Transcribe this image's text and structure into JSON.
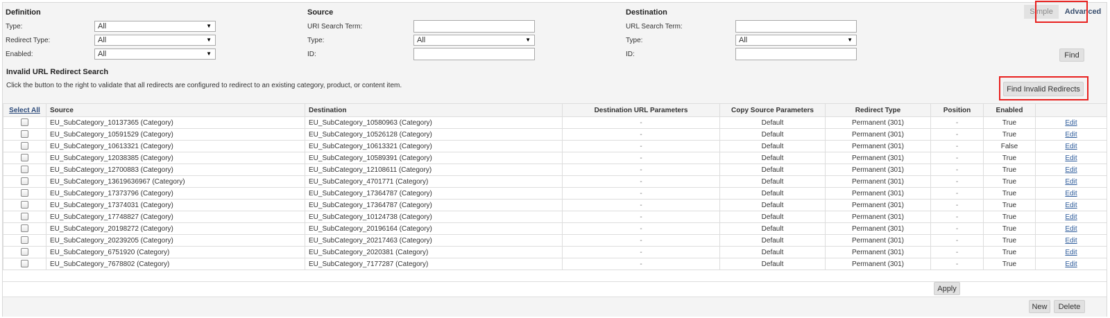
{
  "modes": {
    "simple": "Simple",
    "advanced": "Advanced"
  },
  "definition": {
    "title": "Definition",
    "type_label": "Type:",
    "type_value": "All",
    "redirect_type_label": "Redirect Type:",
    "redirect_type_value": "All",
    "enabled_label": "Enabled:",
    "enabled_value": "All"
  },
  "source": {
    "title": "Source",
    "search_label": "URI Search Term:",
    "search_value": "",
    "type_label": "Type:",
    "type_value": "All",
    "id_label": "ID:",
    "id_value": ""
  },
  "destination": {
    "title": "Destination",
    "search_label": "URL Search Term:",
    "search_value": "",
    "type_label": "Type:",
    "type_value": "All",
    "id_label": "ID:",
    "id_value": ""
  },
  "find_button": "Find",
  "invalid": {
    "title": "Invalid URL Redirect Search",
    "description": "Click the button to the right to validate that all redirects are configured to redirect to an existing category, product, or content item.",
    "button": "Find Invalid Redirects"
  },
  "table": {
    "headers": {
      "select_all": "Select All",
      "source": "Source",
      "destination": "Destination",
      "dest_params": "Destination URL Parameters",
      "copy_params": "Copy Source Parameters",
      "redirect_type": "Redirect Type",
      "position": "Position",
      "enabled": "Enabled"
    },
    "edit_label": "Edit",
    "rows": [
      {
        "source": "EU_SubCategory_10137365 (Category)",
        "destination": "EU_SubCategory_10580963  (Category)",
        "params": "-",
        "copy": "Default",
        "redirect": "Permanent (301)",
        "position": "-",
        "enabled": "True"
      },
      {
        "source": "EU_SubCategory_10591529 (Category)",
        "destination": "EU_SubCategory_10526128  (Category)",
        "params": "-",
        "copy": "Default",
        "redirect": "Permanent (301)",
        "position": "-",
        "enabled": "True"
      },
      {
        "source": "EU_SubCategory_10613321 (Category)",
        "destination": "EU_SubCategory_10613321  (Category)",
        "params": "-",
        "copy": "Default",
        "redirect": "Permanent (301)",
        "position": "-",
        "enabled": "False"
      },
      {
        "source": "EU_SubCategory_12038385 (Category)",
        "destination": "EU_SubCategory_10589391  (Category)",
        "params": "-",
        "copy": "Default",
        "redirect": "Permanent (301)",
        "position": "-",
        "enabled": "True"
      },
      {
        "source": "EU_SubCategory_12700883 (Category)",
        "destination": "EU_SubCategory_12108611  (Category)",
        "params": "-",
        "copy": "Default",
        "redirect": "Permanent (301)",
        "position": "-",
        "enabled": "True"
      },
      {
        "source": "EU_SubCategory_13619636967 (Category)",
        "destination": "EU_SubCategory_4701771  (Category)",
        "params": "-",
        "copy": "Default",
        "redirect": "Permanent (301)",
        "position": "-",
        "enabled": "True"
      },
      {
        "source": "EU_SubCategory_17373796 (Category)",
        "destination": "EU_SubCategory_17364787  (Category)",
        "params": "-",
        "copy": "Default",
        "redirect": "Permanent (301)",
        "position": "-",
        "enabled": "True"
      },
      {
        "source": "EU_SubCategory_17374031 (Category)",
        "destination": "EU_SubCategory_17364787  (Category)",
        "params": "-",
        "copy": "Default",
        "redirect": "Permanent (301)",
        "position": "-",
        "enabled": "True"
      },
      {
        "source": "EU_SubCategory_17748827 (Category)",
        "destination": "EU_SubCategory_10124738  (Category)",
        "params": "-",
        "copy": "Default",
        "redirect": "Permanent (301)",
        "position": "-",
        "enabled": "True"
      },
      {
        "source": "EU_SubCategory_20198272 (Category)",
        "destination": "EU_SubCategory_20196164  (Category)",
        "params": "-",
        "copy": "Default",
        "redirect": "Permanent (301)",
        "position": "-",
        "enabled": "True"
      },
      {
        "source": "EU_SubCategory_20239205 (Category)",
        "destination": "EU_SubCategory_20217463  (Category)",
        "params": "-",
        "copy": "Default",
        "redirect": "Permanent (301)",
        "position": "-",
        "enabled": "True"
      },
      {
        "source": "EU_SubCategory_6751920 (Category)",
        "destination": "EU_SubCategory_2020381  (Category)",
        "params": "-",
        "copy": "Default",
        "redirect": "Permanent (301)",
        "position": "-",
        "enabled": "True"
      },
      {
        "source": "EU_SubCategory_7678802 (Category)",
        "destination": "EU_SubCategory_7177287  (Category)",
        "params": "-",
        "copy": "Default",
        "redirect": "Permanent (301)",
        "position": "-",
        "enabled": "True"
      }
    ]
  },
  "buttons": {
    "apply": "Apply",
    "new": "New",
    "delete": "Delete"
  },
  "colors": {
    "highlight": "#e8201e",
    "link": "#2c5a9a",
    "panel": "#f4f4f4"
  }
}
